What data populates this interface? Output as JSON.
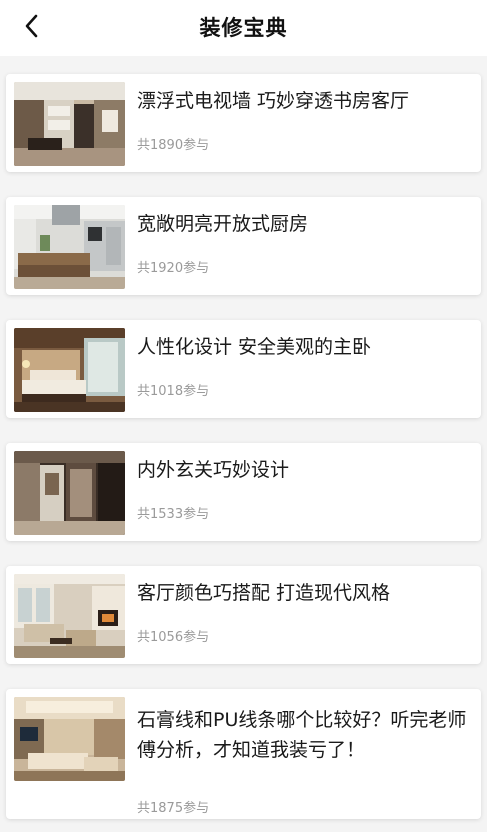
{
  "header": {
    "title": "装修宝典",
    "back_icon": "chevron-left-icon"
  },
  "articles": [
    {
      "title": "漂浮式电视墙 巧妙穿透书房客厅",
      "participants": "共1890参与",
      "image": "living-room-tv-wall-photo"
    },
    {
      "title": "宽敞明亮开放式厨房",
      "participants": "共1920参与",
      "image": "open-kitchen-photo"
    },
    {
      "title": "人性化设计 安全美观的主卧",
      "participants": "共1018参与",
      "image": "master-bedroom-photo"
    },
    {
      "title": "内外玄关巧妙设计",
      "participants": "共1533参与",
      "image": "entryway-photo"
    },
    {
      "title": "客厅颜色巧搭配 打造现代风格",
      "participants": "共1056参与",
      "image": "living-room-photo"
    },
    {
      "title": "石膏线和PU线条哪个比较好？听完老师傅分析，才知道我装亏了！",
      "participants": "共1875参与",
      "image": "ceiling-molding-photo"
    }
  ],
  "colors": {
    "background": "#f4f4f4",
    "card": "#ffffff",
    "title_text": "#1a1a1a",
    "meta_text": "#9a9a9a"
  }
}
